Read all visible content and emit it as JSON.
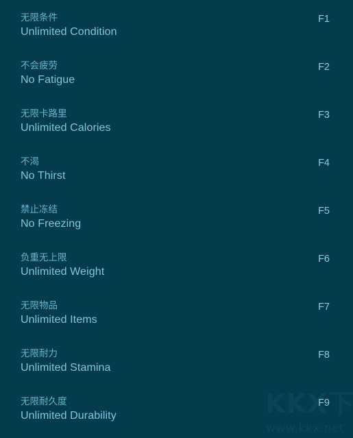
{
  "panel": {
    "background_color": "#043b4d",
    "chinese_text_color": "#69b4cf",
    "english_text_color": "#7fc6de",
    "hotkey_text_color": "#8ccbe2"
  },
  "watermark": {
    "logo": "KKX下载",
    "url": "www.kkx.net",
    "color": "#0a4457"
  },
  "cheats": [
    {
      "name_cn": "无限条件",
      "name_en": "Unlimited Condition",
      "hotkey": "F1"
    },
    {
      "name_cn": "不会疲劳",
      "name_en": "No Fatigue",
      "hotkey": "F2"
    },
    {
      "name_cn": "无限卡路里",
      "name_en": "Unlimited Calories",
      "hotkey": "F3"
    },
    {
      "name_cn": "不渴",
      "name_en": "No Thirst",
      "hotkey": "F4"
    },
    {
      "name_cn": "禁止冻结",
      "name_en": "No Freezing",
      "hotkey": "F5"
    },
    {
      "name_cn": "负重无上限",
      "name_en": "Unlimited Weight",
      "hotkey": "F6"
    },
    {
      "name_cn": "无限物品",
      "name_en": "Unlimited Items",
      "hotkey": "F7"
    },
    {
      "name_cn": "无限耐力",
      "name_en": "Unlimited Stamina",
      "hotkey": "F8"
    },
    {
      "name_cn": "无限耐久度",
      "name_en": "Unlimited Durability",
      "hotkey": "F9"
    }
  ]
}
